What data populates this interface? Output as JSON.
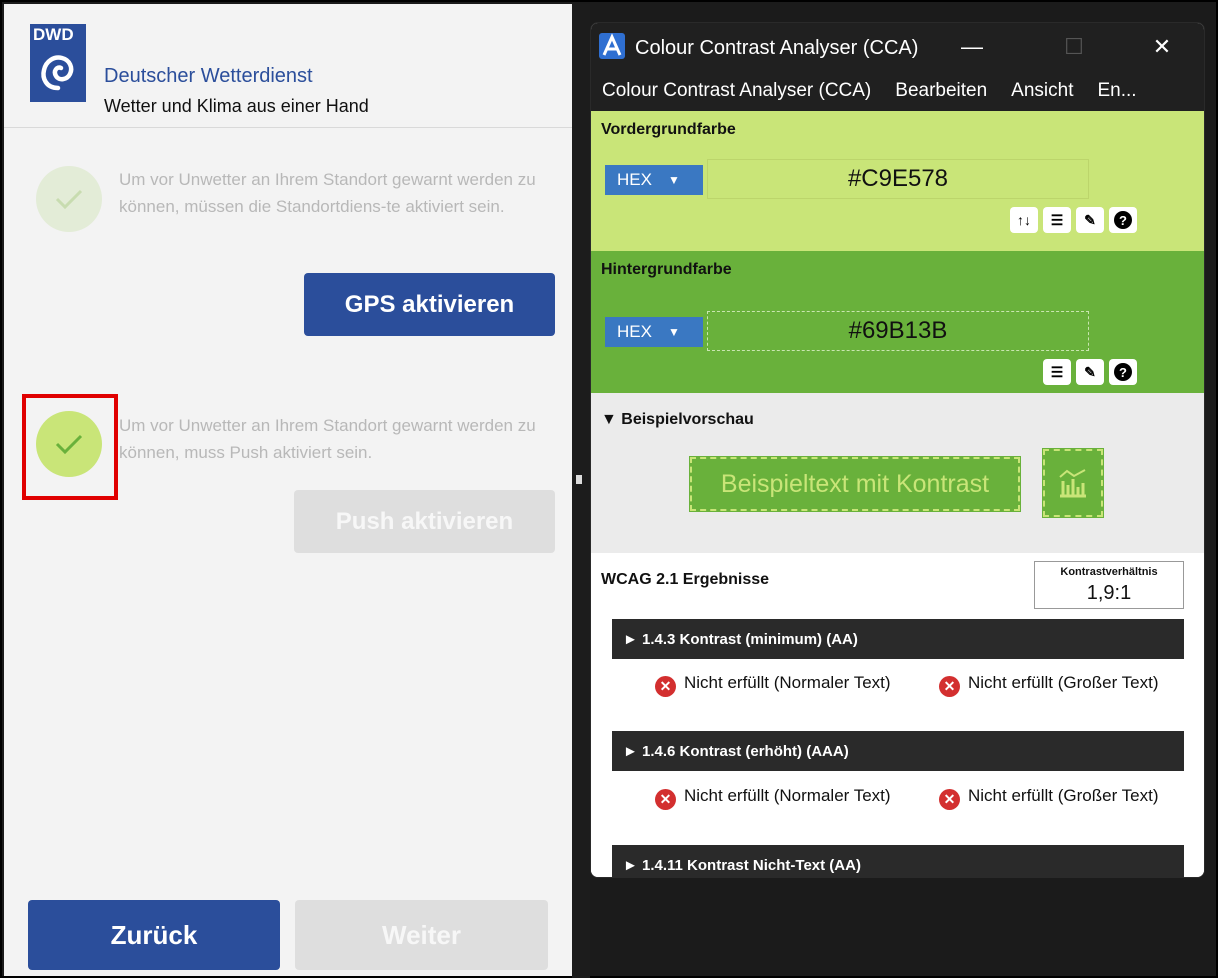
{
  "app": {
    "logo_text": "DWD",
    "brand_name": "Deutscher Wetterdienst",
    "tagline": "Wetter und Klima aus einer Hand",
    "location_permission_text": "Um vor Unwetter an Ihrem Standort gewarnt werden zu können, müssen die Standortdiens-te aktiviert sein.",
    "gps_button": "GPS aktivieren",
    "push_permission_text": "Um vor Unwetter an Ihrem Standort gewarnt werden zu können, muss Push aktiviert sein.",
    "push_button": "Push aktivieren",
    "back_button": "Zurück",
    "next_button": "Weiter",
    "colors": {
      "primary": "#2B4E9B",
      "check_active": "#C9E578",
      "check_inactive": "#E3ECD7",
      "highlight": "#E00000"
    }
  },
  "cca": {
    "window_title": "Colour Contrast Analyser (CCA)",
    "menu": [
      "Colour Contrast Analyser (CCA)",
      "Bearbeiten",
      "Ansicht",
      "En..."
    ],
    "foreground": {
      "title": "Vordergrundfarbe",
      "format": "HEX",
      "value": "#C9E578",
      "color": "#C9E578",
      "tools": [
        "swap-icon",
        "sliders-icon",
        "eyedropper-icon",
        "help-icon"
      ]
    },
    "background": {
      "title": "Hintergrundfarbe",
      "format": "HEX",
      "value": "#69B13B",
      "color": "#69B13B",
      "tools": [
        "sliders-icon",
        "eyedropper-icon",
        "help-icon"
      ]
    },
    "preview": {
      "title": "▼ Beispielvorschau",
      "sample_text": "Beispieltext mit Kontrast"
    },
    "results": {
      "title": "WCAG 2.1 Ergebnisse",
      "ratio_label": "Kontrastverhältnis",
      "ratio_value": "1,9:1",
      "criteria": [
        {
          "label": "► 1.4.3 Kontrast (minimum) (AA)",
          "normal": "Nicht erfüllt (Normaler Text)",
          "large": "Nicht erfüllt (Großer Text)"
        },
        {
          "label": "► 1.4.6 Kontrast (erhöht) (AAA)",
          "normal": "Nicht erfüllt (Normaler Text)",
          "large": "Nicht erfüllt (Großer Text)"
        },
        {
          "label": "► 1.4.11 Kontrast Nicht-Text (AA)"
        }
      ]
    }
  }
}
